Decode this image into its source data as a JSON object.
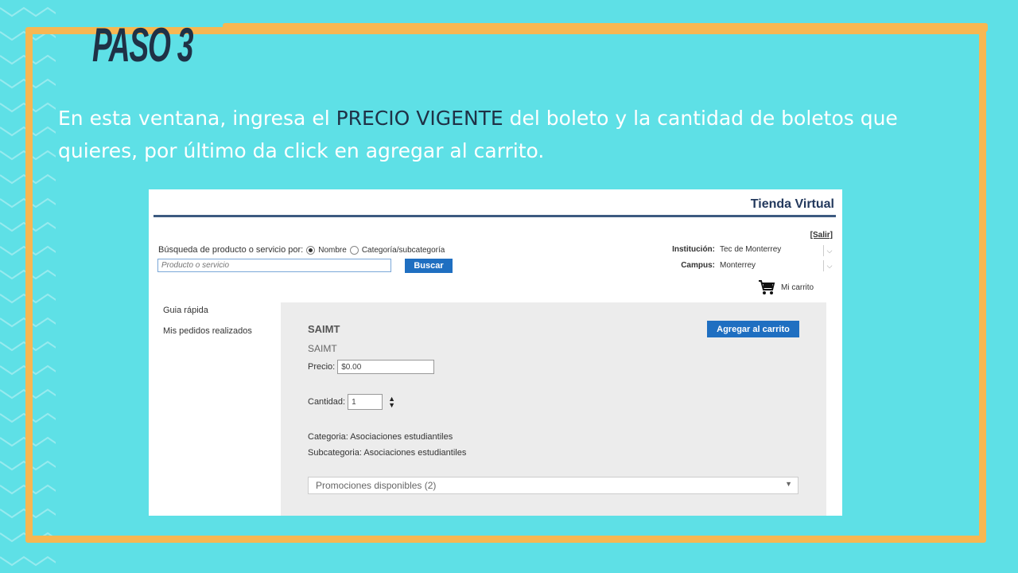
{
  "slide": {
    "step_title": "PASO 3",
    "instruction_before": "En esta ventana, ingresa el ",
    "instruction_highlight": "PRECIO VIGENTE",
    "instruction_after": " del boleto y la cantidad de boletos que quieres, por último da click en agregar al carrito.",
    "colors": {
      "background": "#5ee0e6",
      "frame": "#f7b752",
      "title": "#1f3146",
      "text": "#ffffff"
    }
  },
  "store": {
    "title": "Tienda Virtual",
    "logout": "[Salir]",
    "search": {
      "label": "Búsqueda de producto o servicio por:",
      "option_name": "Nombre",
      "option_category": "Categoría/subcategoría",
      "placeholder": "Producto o servicio",
      "button": "Buscar"
    },
    "institution_label": "Institución:",
    "institution_value": "Tec de Monterrey",
    "campus_label": "Campus:",
    "campus_value": "Monterrey",
    "cart_label": "Mi carrito",
    "nav": [
      "Guia rápida",
      "Mis pedidos realizados"
    ],
    "product": {
      "title": "SAIMT",
      "subtitle": "SAIMT",
      "price_label": "Precio:",
      "price_value": "$0.00",
      "qty_label": "Cantidad:",
      "qty_value": "1",
      "category": "Categoria: Asociaciones estudiantiles",
      "subcategory": "Subcategoria: Asociaciones estudiantiles",
      "promotions": "Promociones disponibles (2)",
      "add_button": "Agregar al carrito"
    },
    "colors": {
      "accent": "#1f6fc1",
      "header_line": "#3d5a80"
    }
  }
}
